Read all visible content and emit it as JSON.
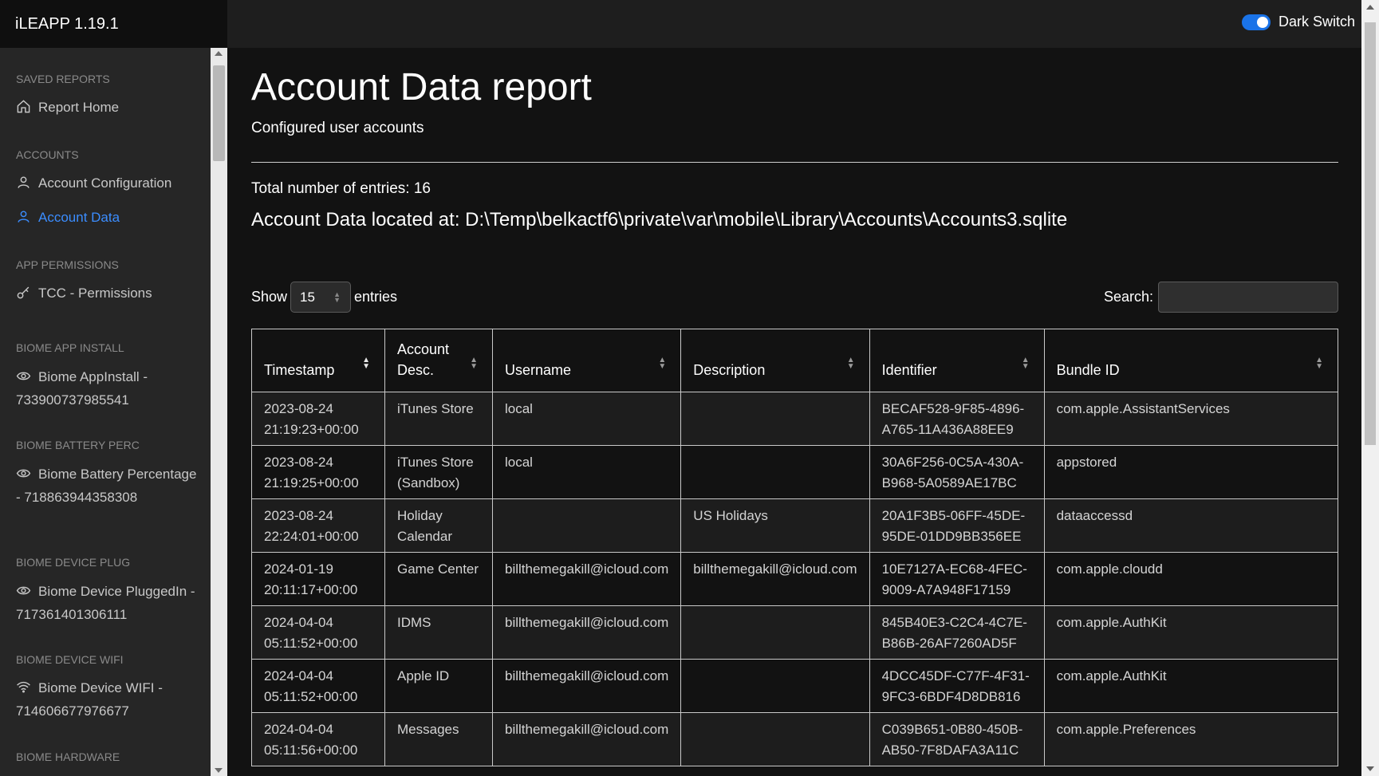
{
  "app": {
    "title": "iLEAPP 1.19.1",
    "dark_switch_label": "Dark Switch"
  },
  "sidebar": {
    "sections": [
      {
        "label": "SAVED REPORTS",
        "items": [
          {
            "label": "Report Home",
            "icon": "home-icon"
          }
        ]
      },
      {
        "label": "ACCOUNTS",
        "items": [
          {
            "label": "Account Configuration",
            "icon": "user-icon"
          },
          {
            "label": "Account Data",
            "icon": "user-icon",
            "active": true
          }
        ]
      },
      {
        "label": "APP PERMISSIONS",
        "items": [
          {
            "label": "TCC - Permissions",
            "icon": "key-icon"
          }
        ]
      },
      {
        "label": "BIOME APP INSTALL",
        "items": [
          {
            "label": "Biome AppInstall - 733900737985541",
            "icon": "eye-icon"
          }
        ]
      },
      {
        "label": "BIOME BATTERY PERC",
        "items": [
          {
            "label": "Biome Battery Percentage - 718863944358308",
            "icon": "eye-icon"
          }
        ]
      },
      {
        "label": "BIOME DEVICE PLUG",
        "items": [
          {
            "label": "Biome Device PluggedIn - 717361401306111",
            "icon": "eye-icon"
          }
        ]
      },
      {
        "label": "BIOME DEVICE WIFI",
        "items": [
          {
            "label": "Biome Device WIFI - 714606677976677",
            "icon": "wifi-icon"
          }
        ]
      },
      {
        "label": "BIOME HARDWARE",
        "items": []
      }
    ]
  },
  "main": {
    "title": "Account Data report",
    "subtitle": "Configured user accounts",
    "total": "Total number of entries: 16",
    "located": "Account Data located at: D:\\Temp\\belkactf6\\private\\var\\mobile\\Library\\Accounts\\Accounts3.sqlite",
    "show_label": "Show",
    "show_value": "15",
    "entries_label": "entries",
    "search_label": "Search:",
    "search_value": ""
  },
  "table": {
    "columns": [
      "Timestamp",
      "Account Desc.",
      "Username",
      "Description",
      "Identifier",
      "Bundle ID"
    ],
    "rows": [
      [
        "2023-08-24 21:19:23+00:00",
        "iTunes Store",
        "local",
        "",
        "BECAF528-9F85-4896-A765-11A436A88EE9",
        "com.apple.AssistantServices"
      ],
      [
        "2023-08-24 21:19:25+00:00",
        "iTunes Store (Sandbox)",
        "local",
        "",
        "30A6F256-0C5A-430A-B968-5A0589AE17BC",
        "appstored"
      ],
      [
        "2023-08-24 22:24:01+00:00",
        "Holiday Calendar",
        "",
        "US Holidays",
        "20A1F3B5-06FF-45DE-95DE-01DD9BB356EE",
        "dataaccessd"
      ],
      [
        "2024-01-19 20:11:17+00:00",
        "Game Center",
        "billthemegakill@icloud.com",
        "billthemegakill@icloud.com",
        "10E7127A-EC68-4FEC-9009-A7A948F17159",
        "com.apple.cloudd"
      ],
      [
        "2024-04-04 05:11:52+00:00",
        "IDMS",
        "billthemegakill@icloud.com",
        "",
        "845B40E3-C2C4-4C7E-B86B-26AF7260AD5F",
        "com.apple.AuthKit"
      ],
      [
        "2024-04-04 05:11:52+00:00",
        "Apple ID",
        "billthemegakill@icloud.com",
        "",
        "4DCC45DF-C77F-4F31-9FC3-6BDF4D8DB816",
        "com.apple.AuthKit"
      ],
      [
        "2024-04-04 05:11:56+00:00",
        "Messages",
        "billthemegakill@icloud.com",
        "",
        "C039B651-0B80-450B-AB50-7F8DAFA3A11C",
        "com.apple.Preferences"
      ]
    ]
  },
  "colors": {
    "accent": "#1a73e8",
    "active_link": "#3b8dff"
  }
}
